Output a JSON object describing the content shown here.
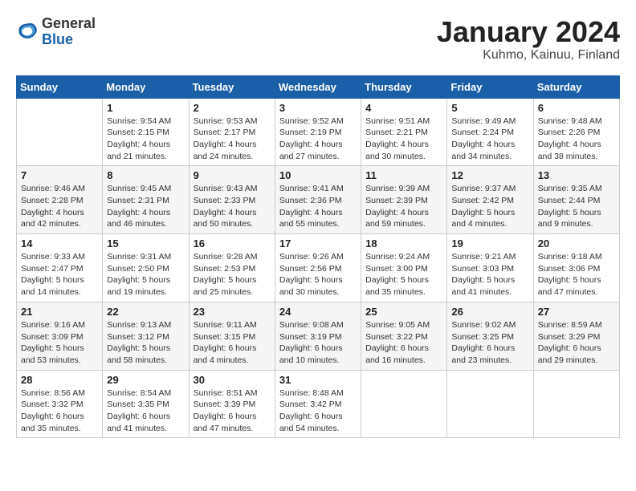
{
  "header": {
    "logo_general": "General",
    "logo_blue": "Blue",
    "title": "January 2024",
    "subtitle": "Kuhmo, Kainuu, Finland"
  },
  "days_of_week": [
    "Sunday",
    "Monday",
    "Tuesday",
    "Wednesday",
    "Thursday",
    "Friday",
    "Saturday"
  ],
  "weeks": [
    [
      {
        "num": "",
        "info": ""
      },
      {
        "num": "1",
        "info": "Sunrise: 9:54 AM\nSunset: 2:15 PM\nDaylight: 4 hours\nand 21 minutes."
      },
      {
        "num": "2",
        "info": "Sunrise: 9:53 AM\nSunset: 2:17 PM\nDaylight: 4 hours\nand 24 minutes."
      },
      {
        "num": "3",
        "info": "Sunrise: 9:52 AM\nSunset: 2:19 PM\nDaylight: 4 hours\nand 27 minutes."
      },
      {
        "num": "4",
        "info": "Sunrise: 9:51 AM\nSunset: 2:21 PM\nDaylight: 4 hours\nand 30 minutes."
      },
      {
        "num": "5",
        "info": "Sunrise: 9:49 AM\nSunset: 2:24 PM\nDaylight: 4 hours\nand 34 minutes."
      },
      {
        "num": "6",
        "info": "Sunrise: 9:48 AM\nSunset: 2:26 PM\nDaylight: 4 hours\nand 38 minutes."
      }
    ],
    [
      {
        "num": "7",
        "info": "Sunrise: 9:46 AM\nSunset: 2:28 PM\nDaylight: 4 hours\nand 42 minutes."
      },
      {
        "num": "8",
        "info": "Sunrise: 9:45 AM\nSunset: 2:31 PM\nDaylight: 4 hours\nand 46 minutes."
      },
      {
        "num": "9",
        "info": "Sunrise: 9:43 AM\nSunset: 2:33 PM\nDaylight: 4 hours\nand 50 minutes."
      },
      {
        "num": "10",
        "info": "Sunrise: 9:41 AM\nSunset: 2:36 PM\nDaylight: 4 hours\nand 55 minutes."
      },
      {
        "num": "11",
        "info": "Sunrise: 9:39 AM\nSunset: 2:39 PM\nDaylight: 4 hours\nand 59 minutes."
      },
      {
        "num": "12",
        "info": "Sunrise: 9:37 AM\nSunset: 2:42 PM\nDaylight: 5 hours\nand 4 minutes."
      },
      {
        "num": "13",
        "info": "Sunrise: 9:35 AM\nSunset: 2:44 PM\nDaylight: 5 hours\nand 9 minutes."
      }
    ],
    [
      {
        "num": "14",
        "info": "Sunrise: 9:33 AM\nSunset: 2:47 PM\nDaylight: 5 hours\nand 14 minutes."
      },
      {
        "num": "15",
        "info": "Sunrise: 9:31 AM\nSunset: 2:50 PM\nDaylight: 5 hours\nand 19 minutes."
      },
      {
        "num": "16",
        "info": "Sunrise: 9:28 AM\nSunset: 2:53 PM\nDaylight: 5 hours\nand 25 minutes."
      },
      {
        "num": "17",
        "info": "Sunrise: 9:26 AM\nSunset: 2:56 PM\nDaylight: 5 hours\nand 30 minutes."
      },
      {
        "num": "18",
        "info": "Sunrise: 9:24 AM\nSunset: 3:00 PM\nDaylight: 5 hours\nand 35 minutes."
      },
      {
        "num": "19",
        "info": "Sunrise: 9:21 AM\nSunset: 3:03 PM\nDaylight: 5 hours\nand 41 minutes."
      },
      {
        "num": "20",
        "info": "Sunrise: 9:18 AM\nSunset: 3:06 PM\nDaylight: 5 hours\nand 47 minutes."
      }
    ],
    [
      {
        "num": "21",
        "info": "Sunrise: 9:16 AM\nSunset: 3:09 PM\nDaylight: 5 hours\nand 53 minutes."
      },
      {
        "num": "22",
        "info": "Sunrise: 9:13 AM\nSunset: 3:12 PM\nDaylight: 5 hours\nand 58 minutes."
      },
      {
        "num": "23",
        "info": "Sunrise: 9:11 AM\nSunset: 3:15 PM\nDaylight: 6 hours\nand 4 minutes."
      },
      {
        "num": "24",
        "info": "Sunrise: 9:08 AM\nSunset: 3:19 PM\nDaylight: 6 hours\nand 10 minutes."
      },
      {
        "num": "25",
        "info": "Sunrise: 9:05 AM\nSunset: 3:22 PM\nDaylight: 6 hours\nand 16 minutes."
      },
      {
        "num": "26",
        "info": "Sunrise: 9:02 AM\nSunset: 3:25 PM\nDaylight: 6 hours\nand 23 minutes."
      },
      {
        "num": "27",
        "info": "Sunrise: 8:59 AM\nSunset: 3:29 PM\nDaylight: 6 hours\nand 29 minutes."
      }
    ],
    [
      {
        "num": "28",
        "info": "Sunrise: 8:56 AM\nSunset: 3:32 PM\nDaylight: 6 hours\nand 35 minutes."
      },
      {
        "num": "29",
        "info": "Sunrise: 8:54 AM\nSunset: 3:35 PM\nDaylight: 6 hours\nand 41 minutes."
      },
      {
        "num": "30",
        "info": "Sunrise: 8:51 AM\nSunset: 3:39 PM\nDaylight: 6 hours\nand 47 minutes."
      },
      {
        "num": "31",
        "info": "Sunrise: 8:48 AM\nSunset: 3:42 PM\nDaylight: 6 hours\nand 54 minutes."
      },
      {
        "num": "",
        "info": ""
      },
      {
        "num": "",
        "info": ""
      },
      {
        "num": "",
        "info": ""
      }
    ]
  ]
}
